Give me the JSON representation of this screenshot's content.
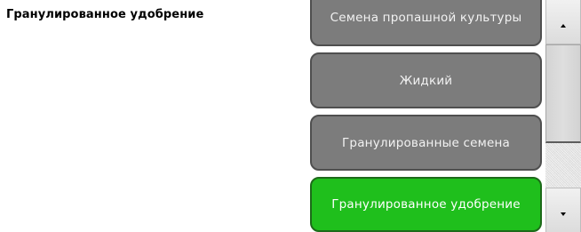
{
  "selected_value": "Гранулированное удобрение",
  "options": [
    {
      "label": "Семена пропашной культуры",
      "selected": false
    },
    {
      "label": "Жидкий",
      "selected": false
    },
    {
      "label": "Гранулированные семена",
      "selected": false
    },
    {
      "label": "Гранулированное удобрение",
      "selected": true
    }
  ],
  "icons": {
    "scroll_up": "triangle-up-icon",
    "scroll_down": "triangle-down-icon"
  },
  "colors": {
    "option_bg": "#7c7c7c",
    "selected_bg": "#1fbf1c",
    "option_text": "#f2f2f2"
  }
}
